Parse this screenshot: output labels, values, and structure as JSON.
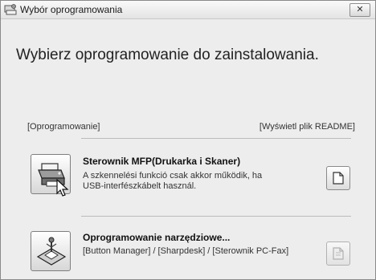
{
  "window": {
    "title": "Wybór oprogramowania",
    "close_label": "✕"
  },
  "heading": "Wybierz oprogramowanie do zainstalowania.",
  "section": {
    "left_label": "[Oprogramowanie]",
    "right_label": "[Wyświetl plik README]"
  },
  "items": [
    {
      "title": "Sterownik MFP(Drukarka i Skaner)",
      "desc_line1": "A szkennelési funkció csak akkor működik, ha",
      "desc_line2": "USB-interfészkábelt használ.",
      "icon": "printer-scanner-icon",
      "readme_icon": "document-icon"
    },
    {
      "title": "Oprogramowanie narzędziowe...",
      "desc_line1": "[Button Manager] / [Sharpdesk] / [Sterownik PC-Fax]",
      "icon": "utility-software-icon",
      "readme_icon": "document-disabled-icon"
    }
  ]
}
